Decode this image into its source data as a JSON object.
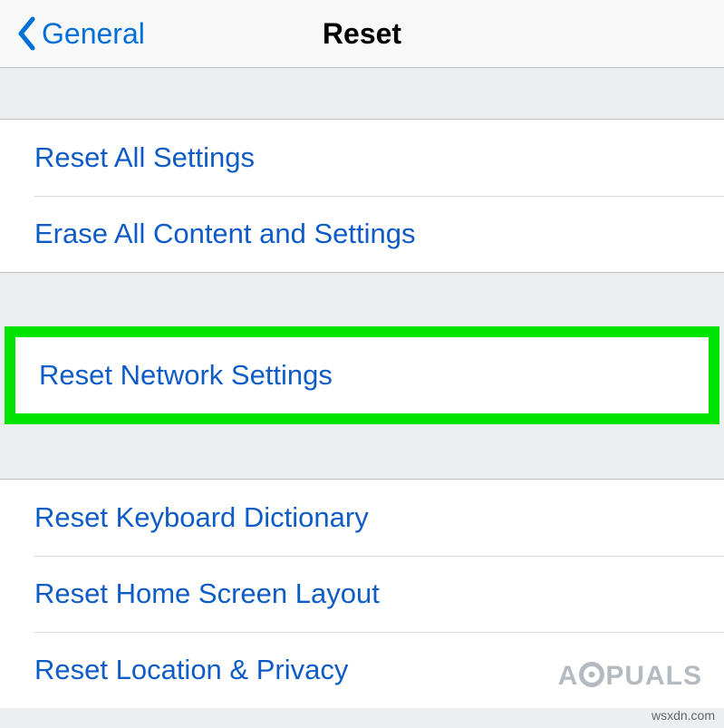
{
  "nav": {
    "back_label": "General",
    "title": "Reset"
  },
  "groups": {
    "g1": {
      "reset_all": "Reset All Settings",
      "erase_all": "Erase All Content and Settings"
    },
    "g2": {
      "reset_network": "Reset Network Settings"
    },
    "g3": {
      "reset_keyboard": "Reset Keyboard Dictionary",
      "reset_home": "Reset Home Screen Layout",
      "reset_location": "Reset Location & Privacy"
    }
  },
  "watermark": {
    "prefix": "A",
    "suffix": "PUALS"
  },
  "source": "wsxdn.com"
}
